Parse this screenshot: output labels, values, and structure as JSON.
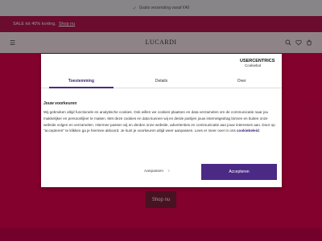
{
  "announcement": {
    "text": "Gratis verzending vanaf €40"
  },
  "sale_bar": {
    "text": "SALE tot 40% korting.",
    "link": "Shop nu"
  },
  "header": {
    "logo": "LUCARDI"
  },
  "hero": {
    "shop_button": "Shop nu"
  },
  "consent": {
    "brand": "USERCENTRICS",
    "brand_sub": "Cookiebot",
    "tabs": [
      {
        "label": "Toestemming",
        "active": true
      },
      {
        "label": "Details",
        "active": false
      },
      {
        "label": "Over",
        "active": false
      }
    ],
    "heading": "Jouw voorkeuren",
    "body": "Wij gebruiken altijd functionele en analytische cookies. Ook willen we cookies plaatsen en data verzamelen om de communicatie naar jou makkelijker en persoonlijker te maken. Met deze cookies en data kunnen wij en derde partijen jouw internetgedrag binnen en buiten onze website volgen en verzamelen. Hiermee passen wij en derden onze website, advertenties en communicatie aan jouw interesses aan. Door op \"accepteren\" te klikken ga je hiermee akkoord. Je kunt je voorkeuren altijd weer aanpassen. Lees er meer over in ons",
    "policy_link": "cookiebeleid",
    "manage_label": "Aanpassen",
    "accept_label": "Accepteren"
  },
  "colors": {
    "sale_bar": "#b8134f",
    "hero": "#e0034f",
    "accent": "#4b2a86"
  }
}
